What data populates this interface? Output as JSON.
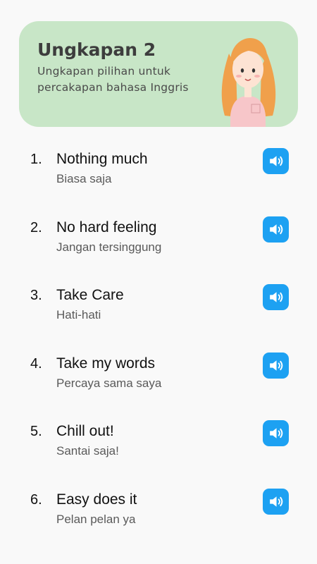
{
  "header": {
    "title": "Ungkapan 2",
    "subtitle": "Ungkapan pilihan untuk percakapan bahasa Inggris"
  },
  "colors": {
    "header_bg": "#c8e6c7",
    "speaker_button": "#1da1f2",
    "background": "#f9f9f9"
  },
  "items": [
    {
      "number": "1.",
      "phrase": "Nothing much",
      "translation": "Biasa saja",
      "icon": "speaker-icon"
    },
    {
      "number": "2.",
      "phrase": "No hard feeling",
      "translation": "Jangan tersinggung",
      "icon": "speaker-icon"
    },
    {
      "number": "3.",
      "phrase": "Take Care",
      "translation": "Hati-hati",
      "icon": "speaker-icon"
    },
    {
      "number": "4.",
      "phrase": "Take my words",
      "translation": "Percaya sama saya",
      "icon": "speaker-icon"
    },
    {
      "number": "5.",
      "phrase": "Chill out!",
      "translation": "Santai saja!",
      "icon": "speaker-icon"
    },
    {
      "number": "6.",
      "phrase": "Easy does it",
      "translation": "Pelan pelan ya",
      "icon": "speaker-icon"
    }
  ]
}
